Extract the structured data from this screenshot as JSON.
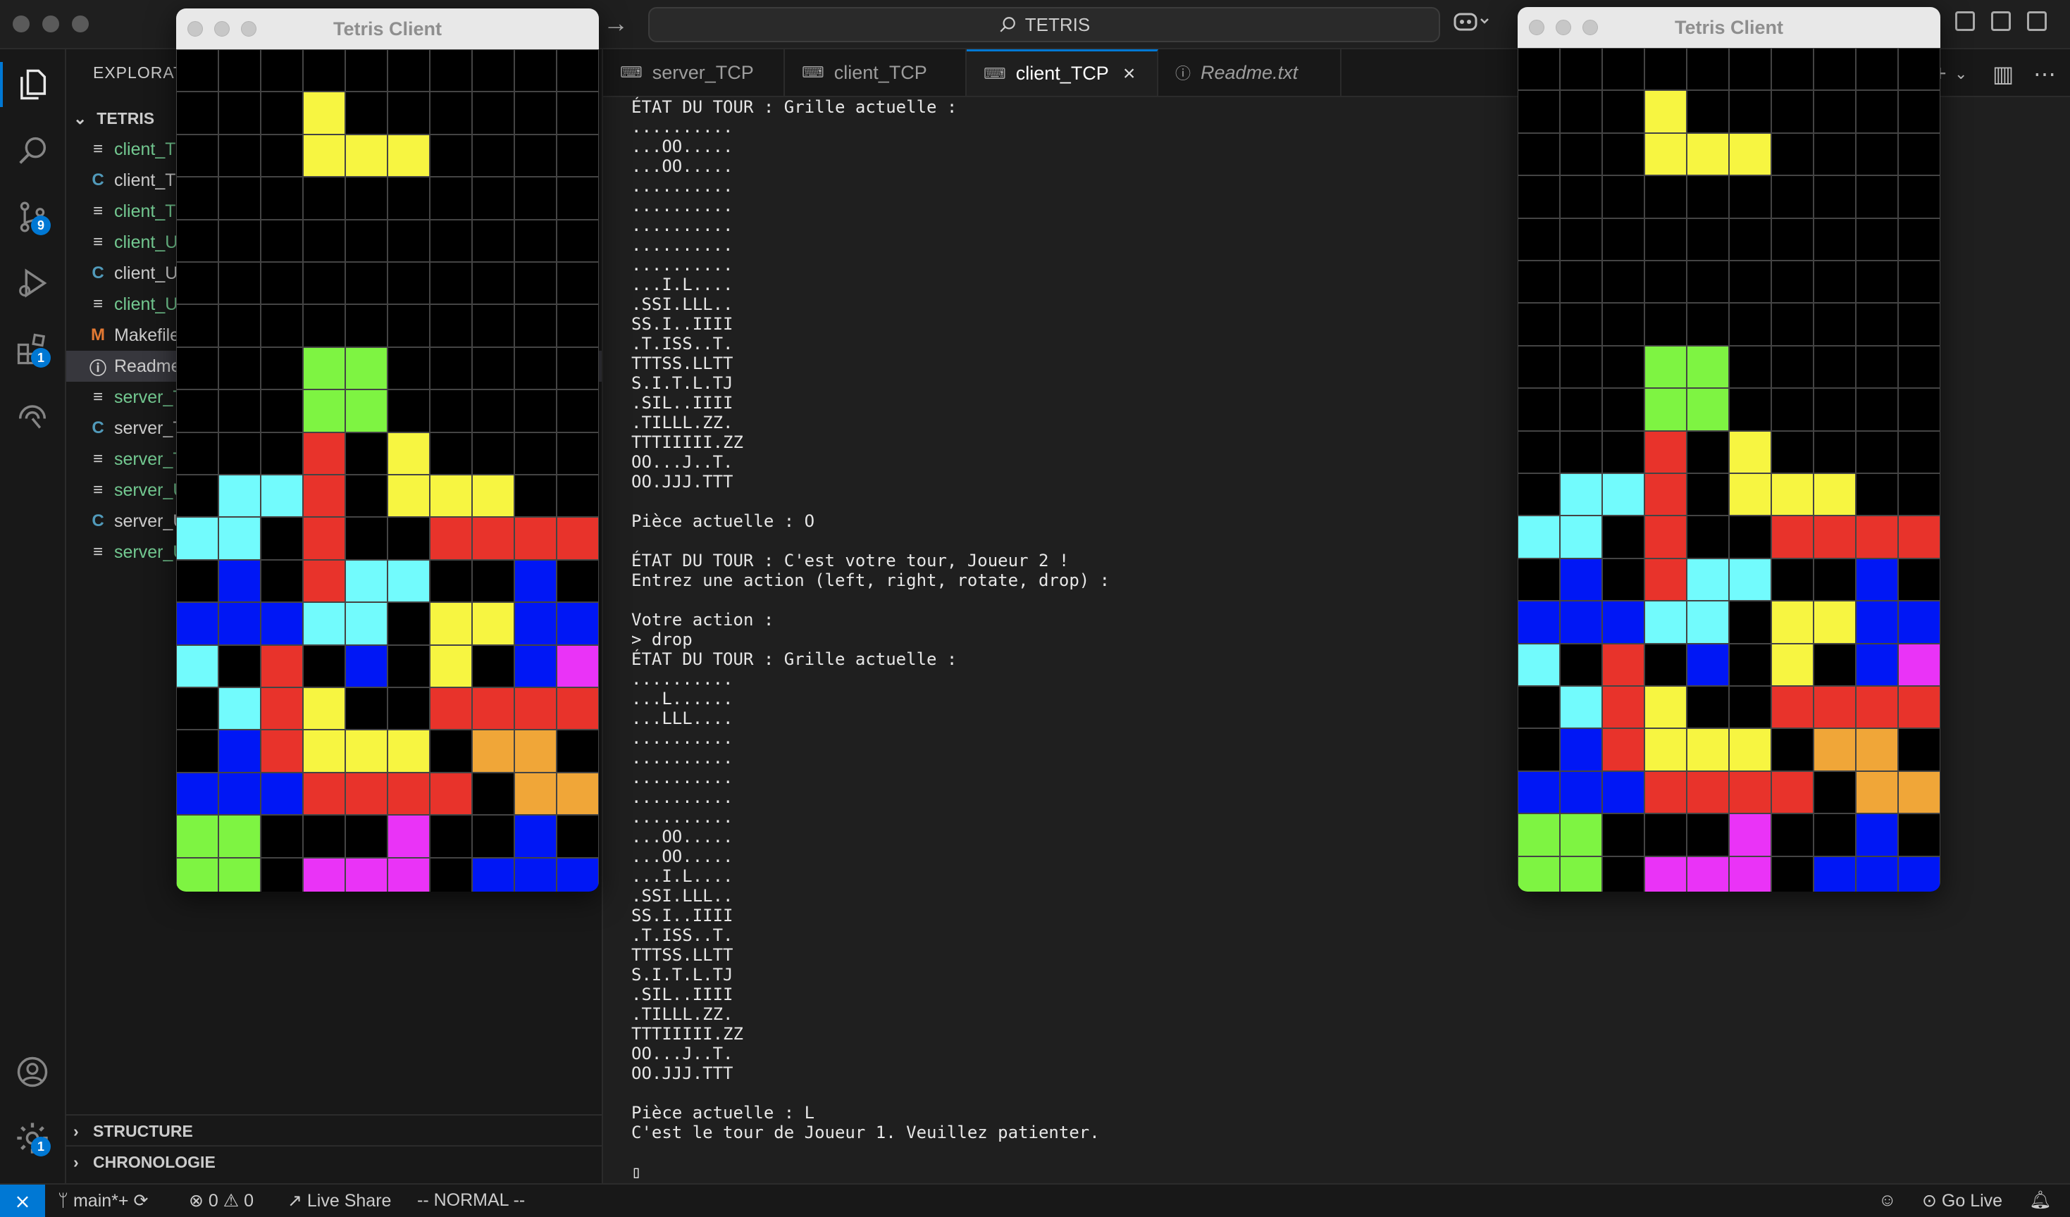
{
  "window": {
    "search_text": "TETRIS"
  },
  "activity_bar": {
    "scm_badge": "9",
    "extensions_badge": "1",
    "settings_badge": "1"
  },
  "sidebar": {
    "title": "EXPLORATEUR",
    "folder": "TETRIS",
    "files": [
      {
        "name": "client_TCP",
        "icon": "≡",
        "color": "#73c991"
      },
      {
        "name": "client_TCP.c",
        "icon": "C",
        "color": "#cccccc"
      },
      {
        "name": "client_TCP.o",
        "icon": "≡",
        "color": "#73c991"
      },
      {
        "name": "client_UDP",
        "icon": "≡",
        "color": "#73c991"
      },
      {
        "name": "client_UDP.c",
        "icon": "C",
        "color": "#cccccc"
      },
      {
        "name": "client_UDP.o",
        "icon": "≡",
        "color": "#73c991"
      },
      {
        "name": "Makefile",
        "icon": "M",
        "color": "#cccccc"
      },
      {
        "name": "Readme.txt",
        "icon": "ⓘ",
        "color": "#cccccc"
      },
      {
        "name": "server_TCP",
        "icon": "≡",
        "color": "#73c991"
      },
      {
        "name": "server_TCP.c",
        "icon": "C",
        "color": "#cccccc"
      },
      {
        "name": "server_TCP.o",
        "icon": "≡",
        "color": "#73c991"
      },
      {
        "name": "server_UDP",
        "icon": "≡",
        "color": "#73c991"
      },
      {
        "name": "server_UDP.c",
        "icon": "C",
        "color": "#cccccc"
      },
      {
        "name": "server_UDP.o",
        "icon": "≡",
        "color": "#73c991"
      }
    ],
    "sections": [
      "STRUCTURE",
      "CHRONOLOGIE"
    ]
  },
  "tabs": [
    {
      "label": "server_TCP",
      "italic": false,
      "active": false
    },
    {
      "label": "client_TCP",
      "italic": false,
      "active": false
    },
    {
      "label": "client_TCP",
      "italic": false,
      "active": true
    },
    {
      "label": "Readme.txt",
      "italic": true,
      "active": false
    }
  ],
  "terminal": {
    "lines": [
      "ÉTAT DU TOUR : Grille actuelle :",
      "..........",
      "...OO.....",
      "...OO.....",
      "..........",
      "..........",
      "..........",
      "..........",
      "..........",
      "...I.L....",
      ".SSI.LLL..",
      "SS.I..IIII",
      ".T.ISS..T.",
      "TTTSS.LLTT",
      "S.I.T.L.TJ",
      ".SIL..IIII",
      ".TILLL.ZZ.",
      "TTTIIIII.ZZ",
      "OO...J..T.",
      "OO.JJJ.TTT",
      "",
      "Pièce actuelle : O",
      "",
      "ÉTAT DU TOUR : C'est votre tour, Joueur 2 !",
      "Entrez une action (left, right, rotate, drop) :",
      "",
      "Votre action :",
      "> drop",
      "ÉTAT DU TOUR : Grille actuelle :",
      "..........",
      "...L......",
      "...LLL....",
      "..........",
      "..........",
      "..........",
      "..........",
      "..........",
      "...OO.....",
      "...OO.....",
      "...I.L....",
      ".SSI.LLL..",
      "SS.I..IIII",
      ".T.ISS..T.",
      "TTTSS.LLTT",
      "S.I.T.L.TJ",
      ".SIL..IIII",
      ".TILLL.ZZ.",
      "TTTIIIII.ZZ",
      "OO...J..T.",
      "OO.JJJ.TTT",
      "",
      "Pièce actuelle : L",
      "C'est le tour de Joueur 1. Veuillez patienter.",
      "",
      "▯"
    ]
  },
  "statusbar": {
    "branch": "main*+",
    "errors": "0",
    "warnings": "0",
    "live_share": "Live Share",
    "vim_mode": "-- NORMAL --",
    "go_live": "Go Live"
  },
  "tetris": {
    "title": "Tetris Client",
    "colors": {
      ".": "#000000",
      "Y": "#f7f541",
      "G": "#7ef442",
      "R": "#e8332b",
      "C": "#72fbfd",
      "B": "#0017f5",
      "M": "#ea33f7",
      "O": "#f0a638"
    },
    "grid": [
      "..........",
      "...Y......",
      "...YYY....",
      "..........",
      "..........",
      "..........",
      "..........",
      "...GG.....",
      "...GG.....",
      "...R.Y....",
      ".CCR.YYY..",
      "CC.R..RRRR",
      ".B.RCC..B.",
      "BBBCC.YYBB",
      "C.R.B.Y.BM",
      ".CRY..RRRR",
      ".BRYYY.OO.",
      "BBBRRRR.OO",
      "GG...M..B.",
      "GG.MMM.BBB"
    ]
  }
}
